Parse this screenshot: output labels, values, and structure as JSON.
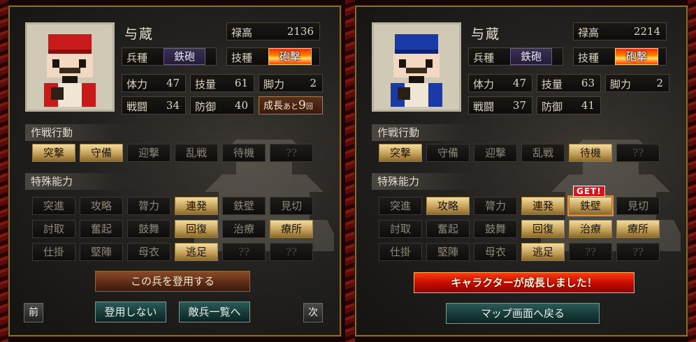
{
  "left": {
    "name": "与蔵",
    "rokudaka_label": "禄高",
    "rokudaka_value": "2136",
    "heishu_label": "兵種",
    "heishu_value": "鉄砲",
    "gishu_label": "技種",
    "gishu_value": "砲撃",
    "stats": [
      {
        "label": "体力",
        "value": "47"
      },
      {
        "label": "技量",
        "value": "61"
      },
      {
        "label": "脚力",
        "value": "2"
      },
      {
        "label": "戦闘",
        "value": "34"
      },
      {
        "label": "防御",
        "value": "40"
      }
    ],
    "growth_label": "成長",
    "growth_small": "あと",
    "growth_num": "9",
    "growth_unit": "回",
    "section_tactics": "作戦行動",
    "tactics": [
      {
        "label": "突撃",
        "on": true
      },
      {
        "label": "守備",
        "on": true
      },
      {
        "label": "迎撃",
        "on": false
      },
      {
        "label": "乱戦",
        "on": false
      },
      {
        "label": "待機",
        "on": false
      },
      {
        "label": "??",
        "on": false
      }
    ],
    "section_abilities": "特殊能力",
    "abilities": [
      {
        "label": "突進",
        "on": false
      },
      {
        "label": "攻略",
        "on": false
      },
      {
        "label": "膂力",
        "on": false
      },
      {
        "label": "連発",
        "on": true
      },
      {
        "label": "鉄壁",
        "on": false
      },
      {
        "label": "見切",
        "on": false
      },
      {
        "label": "討取",
        "on": false
      },
      {
        "label": "奮起",
        "on": false
      },
      {
        "label": "鼓舞",
        "on": false
      },
      {
        "label": "回復",
        "on": true
      },
      {
        "label": "治療",
        "on": false
      },
      {
        "label": "療所",
        "on": true
      },
      {
        "label": "仕掛",
        "on": false
      },
      {
        "label": "堅陣",
        "on": false
      },
      {
        "label": "母衣",
        "on": false
      },
      {
        "label": "逃足",
        "on": true
      },
      {
        "label": "??",
        "on": false
      },
      {
        "label": "??",
        "on": false
      }
    ],
    "recruit_button": "この兵を登用する",
    "prev_button": "前",
    "next_button": "次",
    "decline_button": "登用しない",
    "enemy_list_button": "敵兵一覧へ"
  },
  "right": {
    "name": "与蔵",
    "rokudaka_label": "禄高",
    "rokudaka_value": "2214",
    "heishu_label": "兵種",
    "heishu_value": "鉄砲",
    "gishu_label": "技種",
    "gishu_value": "砲撃",
    "stats": [
      {
        "label": "体力",
        "value": "47"
      },
      {
        "label": "技量",
        "value": "63"
      },
      {
        "label": "脚力",
        "value": "2"
      },
      {
        "label": "戦闘",
        "value": "37"
      },
      {
        "label": "防御",
        "value": "41"
      }
    ],
    "section_tactics": "作戦行動",
    "tactics": [
      {
        "label": "突撃",
        "on": true
      },
      {
        "label": "守備",
        "on": false
      },
      {
        "label": "迎撃",
        "on": false
      },
      {
        "label": "乱戦",
        "on": false
      },
      {
        "label": "待機",
        "on": true
      },
      {
        "label": "??",
        "on": false
      }
    ],
    "section_abilities": "特殊能力",
    "abilities": [
      {
        "label": "突進",
        "on": false
      },
      {
        "label": "攻略",
        "on": true
      },
      {
        "label": "膂力",
        "on": false
      },
      {
        "label": "連発",
        "on": true
      },
      {
        "label": "鉄壁",
        "on": true,
        "new": true
      },
      {
        "label": "見切",
        "on": false
      },
      {
        "label": "討取",
        "on": false
      },
      {
        "label": "奮起",
        "on": false
      },
      {
        "label": "鼓舞",
        "on": false
      },
      {
        "label": "回復",
        "on": true
      },
      {
        "label": "治療",
        "on": true
      },
      {
        "label": "療所",
        "on": true
      },
      {
        "label": "仕掛",
        "on": false
      },
      {
        "label": "堅陣",
        "on": false
      },
      {
        "label": "母衣",
        "on": false
      },
      {
        "label": "逃足",
        "on": true
      },
      {
        "label": "??",
        "on": false
      },
      {
        "label": "??",
        "on": false
      }
    ],
    "get_badge": "GET!",
    "growth_banner": "キャラクターが成長しました！",
    "map_button": "マップ画面へ戻る"
  },
  "colors": {
    "frame": "#8a6a30",
    "active_button": "#c6a25a",
    "left_soldier": "#c81a1a",
    "right_soldier": "#1a3aa8"
  }
}
